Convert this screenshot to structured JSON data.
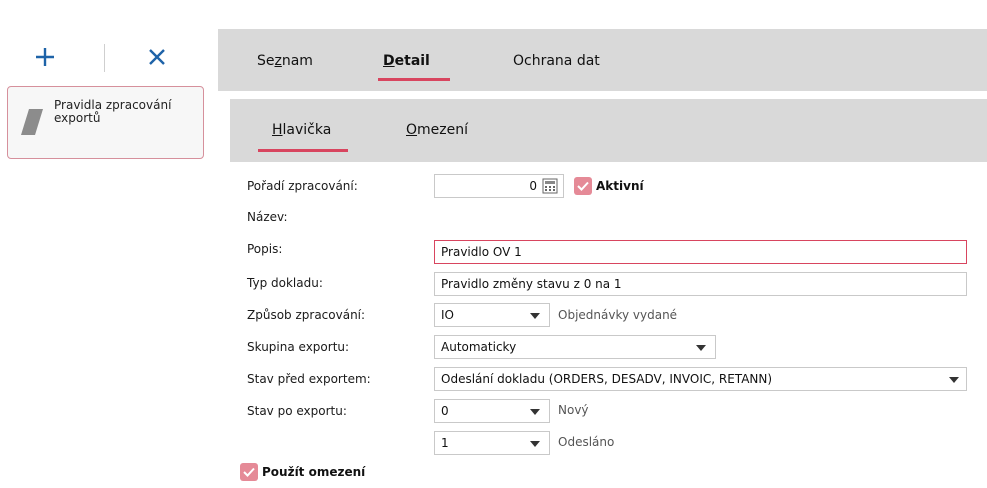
{
  "left_panel": {
    "add_label": "+",
    "delete_label": "×",
    "item_label": "Pravidla zpracování exportů"
  },
  "tabs": {
    "seznam": {
      "first": "Se",
      "u": "z",
      "rest": "nam"
    },
    "detail": {
      "first": "",
      "u": "D",
      "rest": "etail"
    },
    "ochrana": {
      "first": "",
      "u": "",
      "rest": "Ochrana dat"
    }
  },
  "subtabs": {
    "hlavicka": {
      "u": "H",
      "rest": "lavička"
    },
    "omezeni": {
      "u": "O",
      "rest": "mezení"
    }
  },
  "form": {
    "poradi": {
      "label": "Pořadí zpracování:",
      "value": "0"
    },
    "aktivni": {
      "label": "Aktivní",
      "checked": true
    },
    "nazev": {
      "label": "Název:",
      "value": "Pravidlo OV 1"
    },
    "popis": {
      "label": "Popis:",
      "value": "Pravidlo změny stavu z 0 na 1"
    },
    "typ": {
      "label": "Typ dokladu:",
      "value": "IO",
      "hint": "Objednávky vydané"
    },
    "zpusob": {
      "label": "Způsob zpracování:",
      "value": "Automaticky"
    },
    "skupina": {
      "label": "Skupina exportu:",
      "value": "Odeslání dokladu (ORDERS, DESADV, INVOIC, RETANN)"
    },
    "stav_pred": {
      "label": "Stav před exportem:",
      "value": "0",
      "hint": "Nový"
    },
    "stav_po": {
      "label": "Stav po exportu:",
      "value": "1",
      "hint": "Odesláno"
    },
    "pouzit": {
      "label": "Použít omezení",
      "checked": true
    }
  },
  "colors": {
    "accent": "#d8455f",
    "checkbox": "#e58a97",
    "tab_bg": "#d9d9d9",
    "toolbar_icon": "#1e63a8"
  }
}
